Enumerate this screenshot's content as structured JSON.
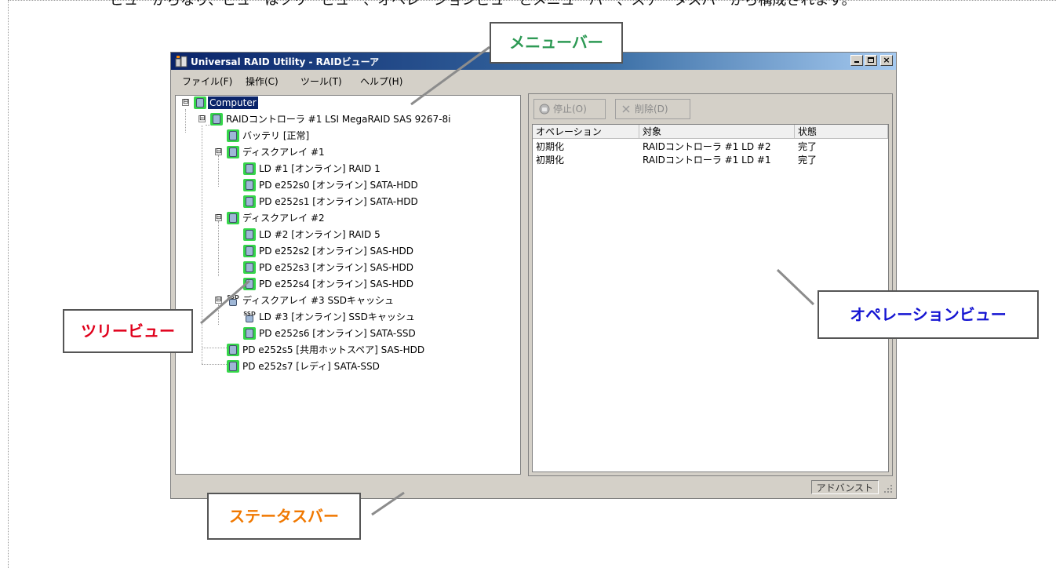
{
  "window": {
    "title": "Universal RAID Utility - RAIDビューア",
    "controls": {
      "minimize": "_",
      "maximize": "□",
      "close": "×"
    }
  },
  "menu": {
    "items": [
      "ファイル(F)",
      "操作(C)",
      "ツール(T)",
      "ヘルプ(H)"
    ]
  },
  "tree": {
    "nodes": [
      {
        "label": "Computer",
        "icon": "computer-icon",
        "expander": "⊟"
      },
      {
        "label": "RAIDコントローラ #1 LSI MegaRAID SAS 9267-8i",
        "icon": "raid-controller-icon",
        "expander": "⊟"
      },
      {
        "label": "バッテリ [正常]",
        "icon": "battery-icon"
      },
      {
        "label": "ディスクアレイ #1",
        "icon": "disk-array-icon",
        "expander": "⊟"
      },
      {
        "label": "LD #1 [オンライン] RAID 1",
        "icon": "logical-drive-icon"
      },
      {
        "label": "PD e252s0 [オンライン] SATA-HDD",
        "icon": "physical-drive-icon"
      },
      {
        "label": "PD e252s1 [オンライン] SATA-HDD",
        "icon": "physical-drive-icon"
      },
      {
        "label": "ディスクアレイ #2",
        "icon": "disk-array-icon",
        "expander": "⊟"
      },
      {
        "label": "LD #2 [オンライン] RAID 5",
        "icon": "logical-drive-icon"
      },
      {
        "label": "PD e252s2 [オンライン] SAS-HDD",
        "icon": "physical-drive-icon"
      },
      {
        "label": "PD e252s3 [オンライン] SAS-HDD",
        "icon": "physical-drive-icon"
      },
      {
        "label": "PD e252s4 [オンライン] SAS-HDD",
        "icon": "physical-drive-icon"
      },
      {
        "label": "ディスクアレイ #3 SSDキャッシュ",
        "icon": "ssd-array-icon",
        "expander": "⊟"
      },
      {
        "label": "LD #3 [オンライン] SSDキャッシュ",
        "icon": "ssd-logical-drive-icon"
      },
      {
        "label": "PD e252s6 [オンライン] SATA-SSD",
        "icon": "physical-drive-icon"
      },
      {
        "label": "PD e252s5 [共用ホットスペア] SAS-HDD",
        "icon": "hotspare-drive-icon"
      },
      {
        "label": "PD e252s7 [レディ] SATA-SSD",
        "icon": "ready-drive-icon"
      }
    ]
  },
  "operations": {
    "toolbar": {
      "stop_label": "停止(O)",
      "delete_label": "削除(D)"
    },
    "columns": [
      "オペレーション",
      "対象",
      "状態"
    ],
    "rows": [
      [
        "初期化",
        "RAIDコントローラ #1  LD #2",
        "完了"
      ],
      [
        "初期化",
        "RAIDコントローラ #1  LD #1",
        "完了"
      ]
    ]
  },
  "statusbar": {
    "mode": "アドバンスト"
  },
  "callouts": {
    "menubar": "メニューバー",
    "treeview": "ツリービュー",
    "operationview": "オペレーションビュー",
    "statusbar": "ステータスバー"
  },
  "colors": {
    "menubar_callout": "#2e9a55",
    "treeview_callout": "#e0001b",
    "operationview_callout": "#1414d2",
    "statusbar_callout": "#f07800",
    "title_gradient_start": "#0a246a",
    "icon_highlight": "#35d64a"
  }
}
